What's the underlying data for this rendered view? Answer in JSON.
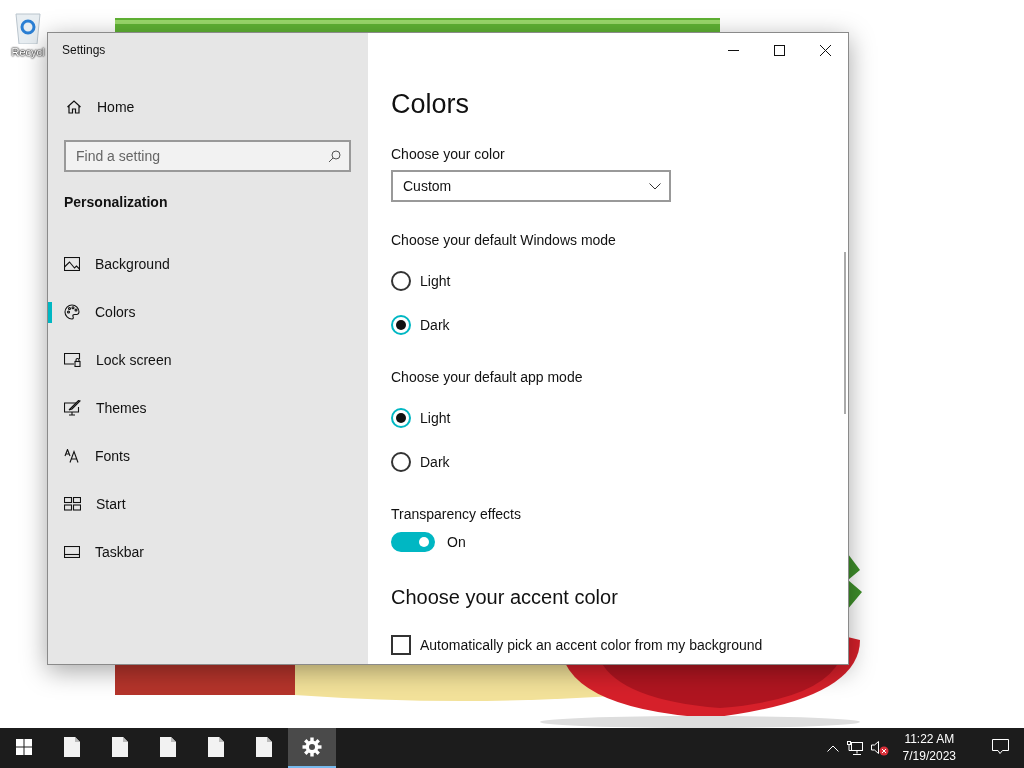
{
  "desktop": {
    "icons": [
      {
        "label": "Recycl"
      }
    ]
  },
  "window": {
    "title": "Settings"
  },
  "sidebar": {
    "home": "Home",
    "search": {
      "placeholder": "Find a setting"
    },
    "section": "Personalization",
    "items": [
      {
        "label": "Background",
        "selected": false
      },
      {
        "label": "Colors",
        "selected": true
      },
      {
        "label": "Lock screen",
        "selected": false
      },
      {
        "label": "Themes",
        "selected": false
      },
      {
        "label": "Fonts",
        "selected": false
      },
      {
        "label": "Start",
        "selected": false
      },
      {
        "label": "Taskbar",
        "selected": false
      }
    ]
  },
  "content": {
    "title": "Colors",
    "color_label": "Choose your color",
    "color_select": "Custom",
    "windows_mode": {
      "label": "Choose your default Windows mode",
      "options": [
        {
          "label": "Light",
          "selected": false
        },
        {
          "label": "Dark",
          "selected": true
        }
      ]
    },
    "app_mode": {
      "label": "Choose your default app mode",
      "options": [
        {
          "label": "Light",
          "selected": true
        },
        {
          "label": "Dark",
          "selected": false
        }
      ]
    },
    "transparency": {
      "label": "Transparency effects",
      "on": true,
      "state_text": "On"
    },
    "accent_heading": "Choose your accent color",
    "auto_accent": {
      "label": "Automatically pick an accent color from my background",
      "checked": false
    }
  },
  "taskbar": {
    "apps": [
      {
        "kind": "file",
        "selected": false
      },
      {
        "kind": "file",
        "selected": false
      },
      {
        "kind": "file",
        "selected": false
      },
      {
        "kind": "file",
        "selected": false
      },
      {
        "kind": "file",
        "selected": false
      },
      {
        "kind": "settings",
        "selected": true
      }
    ],
    "clock": {
      "time": "11:22 AM",
      "date": "7/19/2023"
    }
  }
}
